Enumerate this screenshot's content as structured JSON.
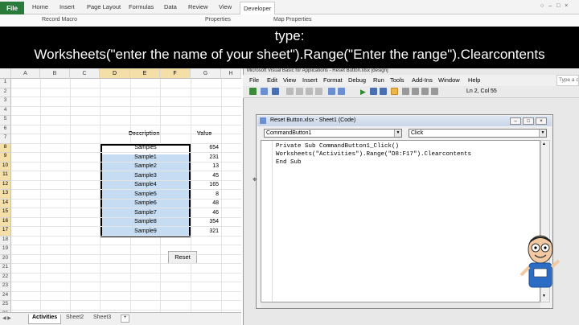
{
  "ribbon": {
    "tabs": [
      "File",
      "Home",
      "Insert",
      "Page Layout",
      "Formulas",
      "Data",
      "Review",
      "View",
      "Developer"
    ],
    "partial_items": [
      "Record Macro",
      "Properties",
      "Map Properties"
    ]
  },
  "banner": {
    "line1": "type:",
    "line2": "Worksheets(\"enter the name of your sheet\").Range(\"Enter the range\").Clearcontents"
  },
  "excel": {
    "columns": [
      "A",
      "B",
      "C",
      "D",
      "E",
      "F",
      "G",
      "H"
    ],
    "selected_columns": [
      "D",
      "E",
      "F"
    ],
    "rows": [
      "1",
      "2",
      "3",
      "4",
      "5",
      "6",
      "7",
      "8",
      "9",
      "10",
      "11",
      "12",
      "13",
      "14",
      "15",
      "16",
      "17",
      "18",
      "19",
      "20",
      "21",
      "22",
      "23",
      "24",
      "25",
      "26"
    ],
    "selected_rows": [
      "8",
      "9",
      "10",
      "11",
      "12",
      "13",
      "14",
      "15",
      "16",
      "17"
    ],
    "header_description": "Description",
    "header_value": "Value",
    "descriptions": [
      "Samples",
      "Sample1",
      "Sample2",
      "Sample3",
      "Sample4",
      "Sample5",
      "Sample6",
      "Sample7",
      "Sample8",
      "Sample9"
    ],
    "values": [
      "654",
      "231",
      "13",
      "45",
      "165",
      "8",
      "48",
      "46",
      "354",
      "321"
    ],
    "reset_button": "Reset",
    "sheet_tabs": [
      "Activities",
      "Sheet2",
      "Sheet3"
    ],
    "active_sheet": "Activities"
  },
  "vbe": {
    "title_partial": "Microsoft Visual Basic for Applications - Reset Button.xlsx [design]",
    "menu": [
      "File",
      "Edit",
      "View",
      "Insert",
      "Format",
      "Debug",
      "Run",
      "Tools",
      "Add-Ins",
      "Window",
      "Help"
    ],
    "status": "Ln 2, Col 55",
    "search_placeholder": "Type a q",
    "code_window": {
      "title": "Reset Button.xlsx - Sheet1 (Code)",
      "object_combo": "CommandButton1",
      "procedure_combo": "Click",
      "code_lines": [
        "Private Sub CommandButton1_Click()",
        "Worksheets(\"Activities\").Range(\"D8:F17\").Clearcontents",
        "End Sub"
      ]
    }
  },
  "colors": {
    "file_tab": "#2a7a3b",
    "selection_fill": "#c5dcf3",
    "selected_header": "#f5dfa8",
    "banner_bg": "#000000",
    "banner_text": "#ffffff"
  }
}
